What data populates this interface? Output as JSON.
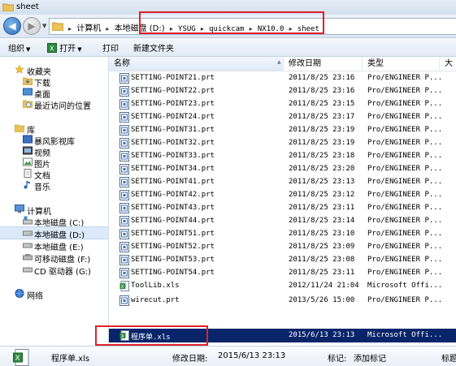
{
  "window": {
    "title": "sheet"
  },
  "address": {
    "crumbs": [
      "计算机",
      "本地磁盘 (D:)",
      "YSUG",
      "quickcam",
      "NX10.0",
      "sheet"
    ]
  },
  "toolbar": {
    "organize": "组织",
    "open": "打开",
    "print": "打印",
    "new_folder": "新建文件夹"
  },
  "nav": {
    "favorites": "收藏夹",
    "downloads": "下载",
    "desktop": "桌面",
    "recent": "最近访问的位置",
    "libraries": "库",
    "storm": "暴风影视库",
    "videos": "视频",
    "pictures": "图片",
    "documents": "文档",
    "music": "音乐",
    "computer": "计算机",
    "drive_c": "本地磁盘 (C:)",
    "drive_d": "本地磁盘 (D:)",
    "drive_e": "本地磁盘 (E:)",
    "removable": "可移动磁盘 (F:)",
    "cd_drive": "CD 驱动器 (G:)",
    "network": "网络"
  },
  "columns": {
    "name": "名称",
    "modified": "修改日期",
    "type": "类型",
    "size": "大"
  },
  "files": [
    {
      "name": "SETTING-POINT21.prt",
      "date": "2011/8/25 23:16",
      "type": "Pro/ENGINEER P...",
      "icon": "prt-icon"
    },
    {
      "name": "SETTING-POINT22.prt",
      "date": "2011/8/25 23:16",
      "type": "Pro/ENGINEER P...",
      "icon": "prt-icon"
    },
    {
      "name": "SETTING-POINT23.prt",
      "date": "2011/8/25 23:15",
      "type": "Pro/ENGINEER P...",
      "icon": "prt-icon"
    },
    {
      "name": "SETTING-POINT24.prt",
      "date": "2011/8/25 23:17",
      "type": "Pro/ENGINEER P...",
      "icon": "prt-icon"
    },
    {
      "name": "SETTING-POINT31.prt",
      "date": "2011/8/25 23:19",
      "type": "Pro/ENGINEER P...",
      "icon": "prt-icon"
    },
    {
      "name": "SETTING-POINT32.prt",
      "date": "2011/8/25 23:19",
      "type": "Pro/ENGINEER P...",
      "icon": "prt-icon"
    },
    {
      "name": "SETTING-POINT33.prt",
      "date": "2011/8/25 23:18",
      "type": "Pro/ENGINEER P...",
      "icon": "prt-icon"
    },
    {
      "name": "SETTING-POINT34.prt",
      "date": "2011/8/25 23:20",
      "type": "Pro/ENGINEER P...",
      "icon": "prt-icon"
    },
    {
      "name": "SETTING-POINT41.prt",
      "date": "2011/8/25 23:13",
      "type": "Pro/ENGINEER P...",
      "icon": "prt-icon"
    },
    {
      "name": "SETTING-POINT42.prt",
      "date": "2011/8/25 23:12",
      "type": "Pro/ENGINEER P...",
      "icon": "prt-icon"
    },
    {
      "name": "SETTING-POINT43.prt",
      "date": "2011/8/25 23:11",
      "type": "Pro/ENGINEER P...",
      "icon": "prt-icon"
    },
    {
      "name": "SETTING-POINT44.prt",
      "date": "2011/8/25 23:14",
      "type": "Pro/ENGINEER P...",
      "icon": "prt-icon"
    },
    {
      "name": "SETTING-POINT51.prt",
      "date": "2011/8/25 23:10",
      "type": "Pro/ENGINEER P...",
      "icon": "prt-icon"
    },
    {
      "name": "SETTING-POINT52.prt",
      "date": "2011/8/25 23:09",
      "type": "Pro/ENGINEER P...",
      "icon": "prt-icon"
    },
    {
      "name": "SETTING-POINT53.prt",
      "date": "2011/8/25 23:08",
      "type": "Pro/ENGINEER P...",
      "icon": "prt-icon"
    },
    {
      "name": "SETTING-POINT54.prt",
      "date": "2011/8/25 23:11",
      "type": "Pro/ENGINEER P...",
      "icon": "prt-icon"
    },
    {
      "name": "ToolLib.xls",
      "date": "2012/11/24 21:04",
      "type": "Microsoft Offi...",
      "icon": "xls-icon"
    },
    {
      "name": "wirecut.prt",
      "date": "2013/5/26 15:00",
      "type": "Pro/ENGINEER P...",
      "icon": "prt-icon"
    },
    {
      "name": "程序单.xls",
      "date": "2015/6/13 23:13",
      "type": "Microsoft Offi...",
      "icon": "xls-icon",
      "selected": true
    }
  ],
  "details": {
    "filename": "程序单.xls",
    "modified_label": "修改日期:",
    "modified_value": "2015/6/13 23:13",
    "tags_label": "标记:",
    "tags_value": "添加标记",
    "title_label": "标题"
  }
}
